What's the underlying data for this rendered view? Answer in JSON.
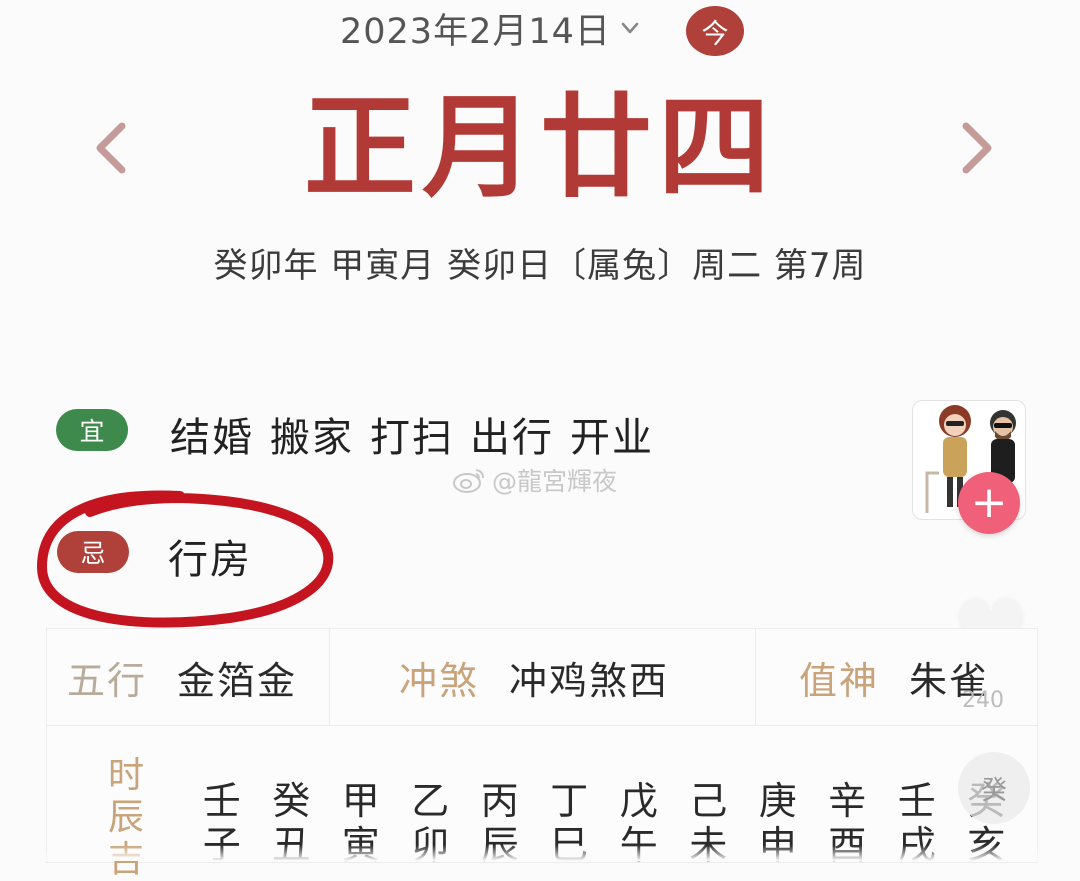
{
  "header": {
    "date_label": "2023年2月14日",
    "today_label": "今",
    "lunar_date": "正月廿四",
    "ganzhi_line": "癸卯年 甲寅月 癸卯日〔属兔〕周二 第7周"
  },
  "yi": {
    "badge": "宜",
    "items": [
      "结婚",
      "搬家",
      "打扫",
      "出行",
      "开业"
    ]
  },
  "ji": {
    "badge": "忌",
    "items": [
      "行房"
    ]
  },
  "watermark": "@龍宮輝夜",
  "info": {
    "wuxing_label": "五行",
    "wuxing_value": "金箔金",
    "chongsha_label": "冲煞",
    "chongsha_value": "冲鸡煞西",
    "zhishen_label": "值神",
    "zhishen_value": "朱雀",
    "shichen_label": "时辰吉",
    "hours": [
      {
        "stem": "壬",
        "branch": "子"
      },
      {
        "stem": "癸",
        "branch": "丑"
      },
      {
        "stem": "甲",
        "branch": "寅"
      },
      {
        "stem": "乙",
        "branch": "卯"
      },
      {
        "stem": "丙",
        "branch": "辰"
      },
      {
        "stem": "丁",
        "branch": "巳"
      },
      {
        "stem": "戊",
        "branch": "午"
      },
      {
        "stem": "己",
        "branch": "未"
      },
      {
        "stem": "庚",
        "branch": "申"
      },
      {
        "stem": "辛",
        "branch": "酉"
      },
      {
        "stem": "壬",
        "branch": "戌"
      },
      {
        "stem": "癸",
        "branch": "亥"
      }
    ]
  },
  "overlay": {
    "side_button": "癸",
    "count": "240"
  },
  "colors": {
    "lunar_red": "#b13a36",
    "yi_green": "#3e8a4d",
    "ji_red": "#b0413a",
    "label_gold": "#c9a37a",
    "marker_red": "#c4141f",
    "add_pink": "#f06078"
  },
  "icons": {
    "date_dropdown": "chevron-down-icon",
    "prev": "chevron-left-icon",
    "next": "chevron-right-icon",
    "weibo": "weibo-logo-icon",
    "add": "plus-icon"
  }
}
